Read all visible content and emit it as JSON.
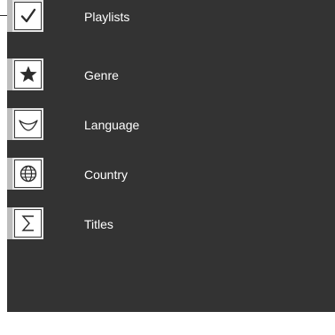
{
  "menu": {
    "items": [
      {
        "label": "Playlists",
        "icon": "checkmark-icon"
      },
      {
        "label": "Genre",
        "icon": "star-icon"
      },
      {
        "label": "Language",
        "icon": "smile-curve-icon"
      },
      {
        "label": "Country",
        "icon": "globe-icon"
      },
      {
        "label": "Titles",
        "icon": "sigma-icon"
      }
    ]
  },
  "colors": {
    "panel_background": "#333333",
    "tile_background": "#e6e6e6",
    "tile_edge": "#bdbdbd",
    "icon_stroke": "#2c2c2c",
    "label_text": "#ffffff"
  }
}
